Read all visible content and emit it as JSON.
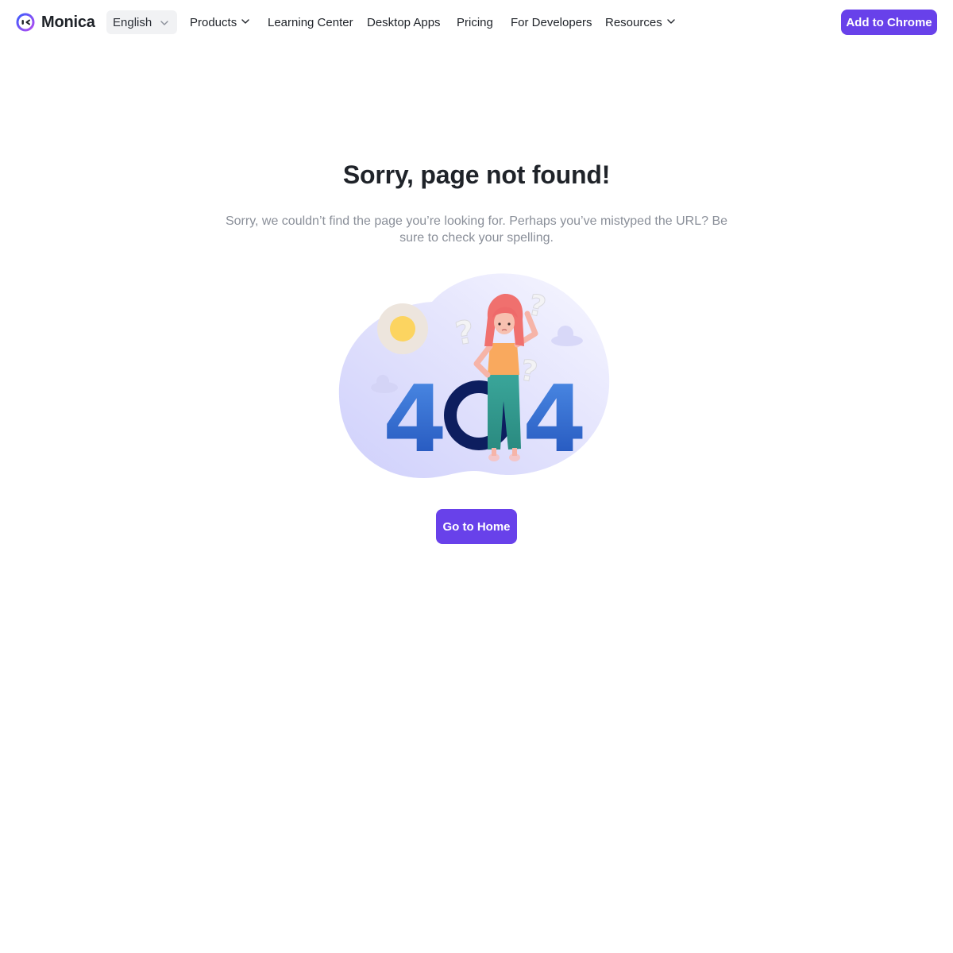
{
  "header": {
    "logo_text": "Monica",
    "language": "English",
    "nav": [
      {
        "label": "Products",
        "has_dropdown": true
      },
      {
        "label": "Learning Center",
        "has_dropdown": false
      },
      {
        "label": "Desktop Apps",
        "has_dropdown": false
      },
      {
        "label": "Pricing",
        "has_dropdown": false
      },
      {
        "label": "For Developers",
        "has_dropdown": false
      },
      {
        "label": "Resources",
        "has_dropdown": true
      }
    ],
    "cta_label": "Add to Chrome"
  },
  "main": {
    "title": "Sorry, page not found!",
    "subtitle": "Sorry, we couldn’t find the page you’re looking for. Perhaps you’ve mistyped the URL? Be sure to check your spelling.",
    "illustration": {
      "icon": "404-illustration",
      "digits": [
        "4",
        "0",
        "4"
      ]
    },
    "home_button_label": "Go to Home"
  },
  "colors": {
    "brand": "#6841ea",
    "title": "#1f2329",
    "subtitle": "#8a8f99",
    "language_bg": "#f1f2f4"
  }
}
